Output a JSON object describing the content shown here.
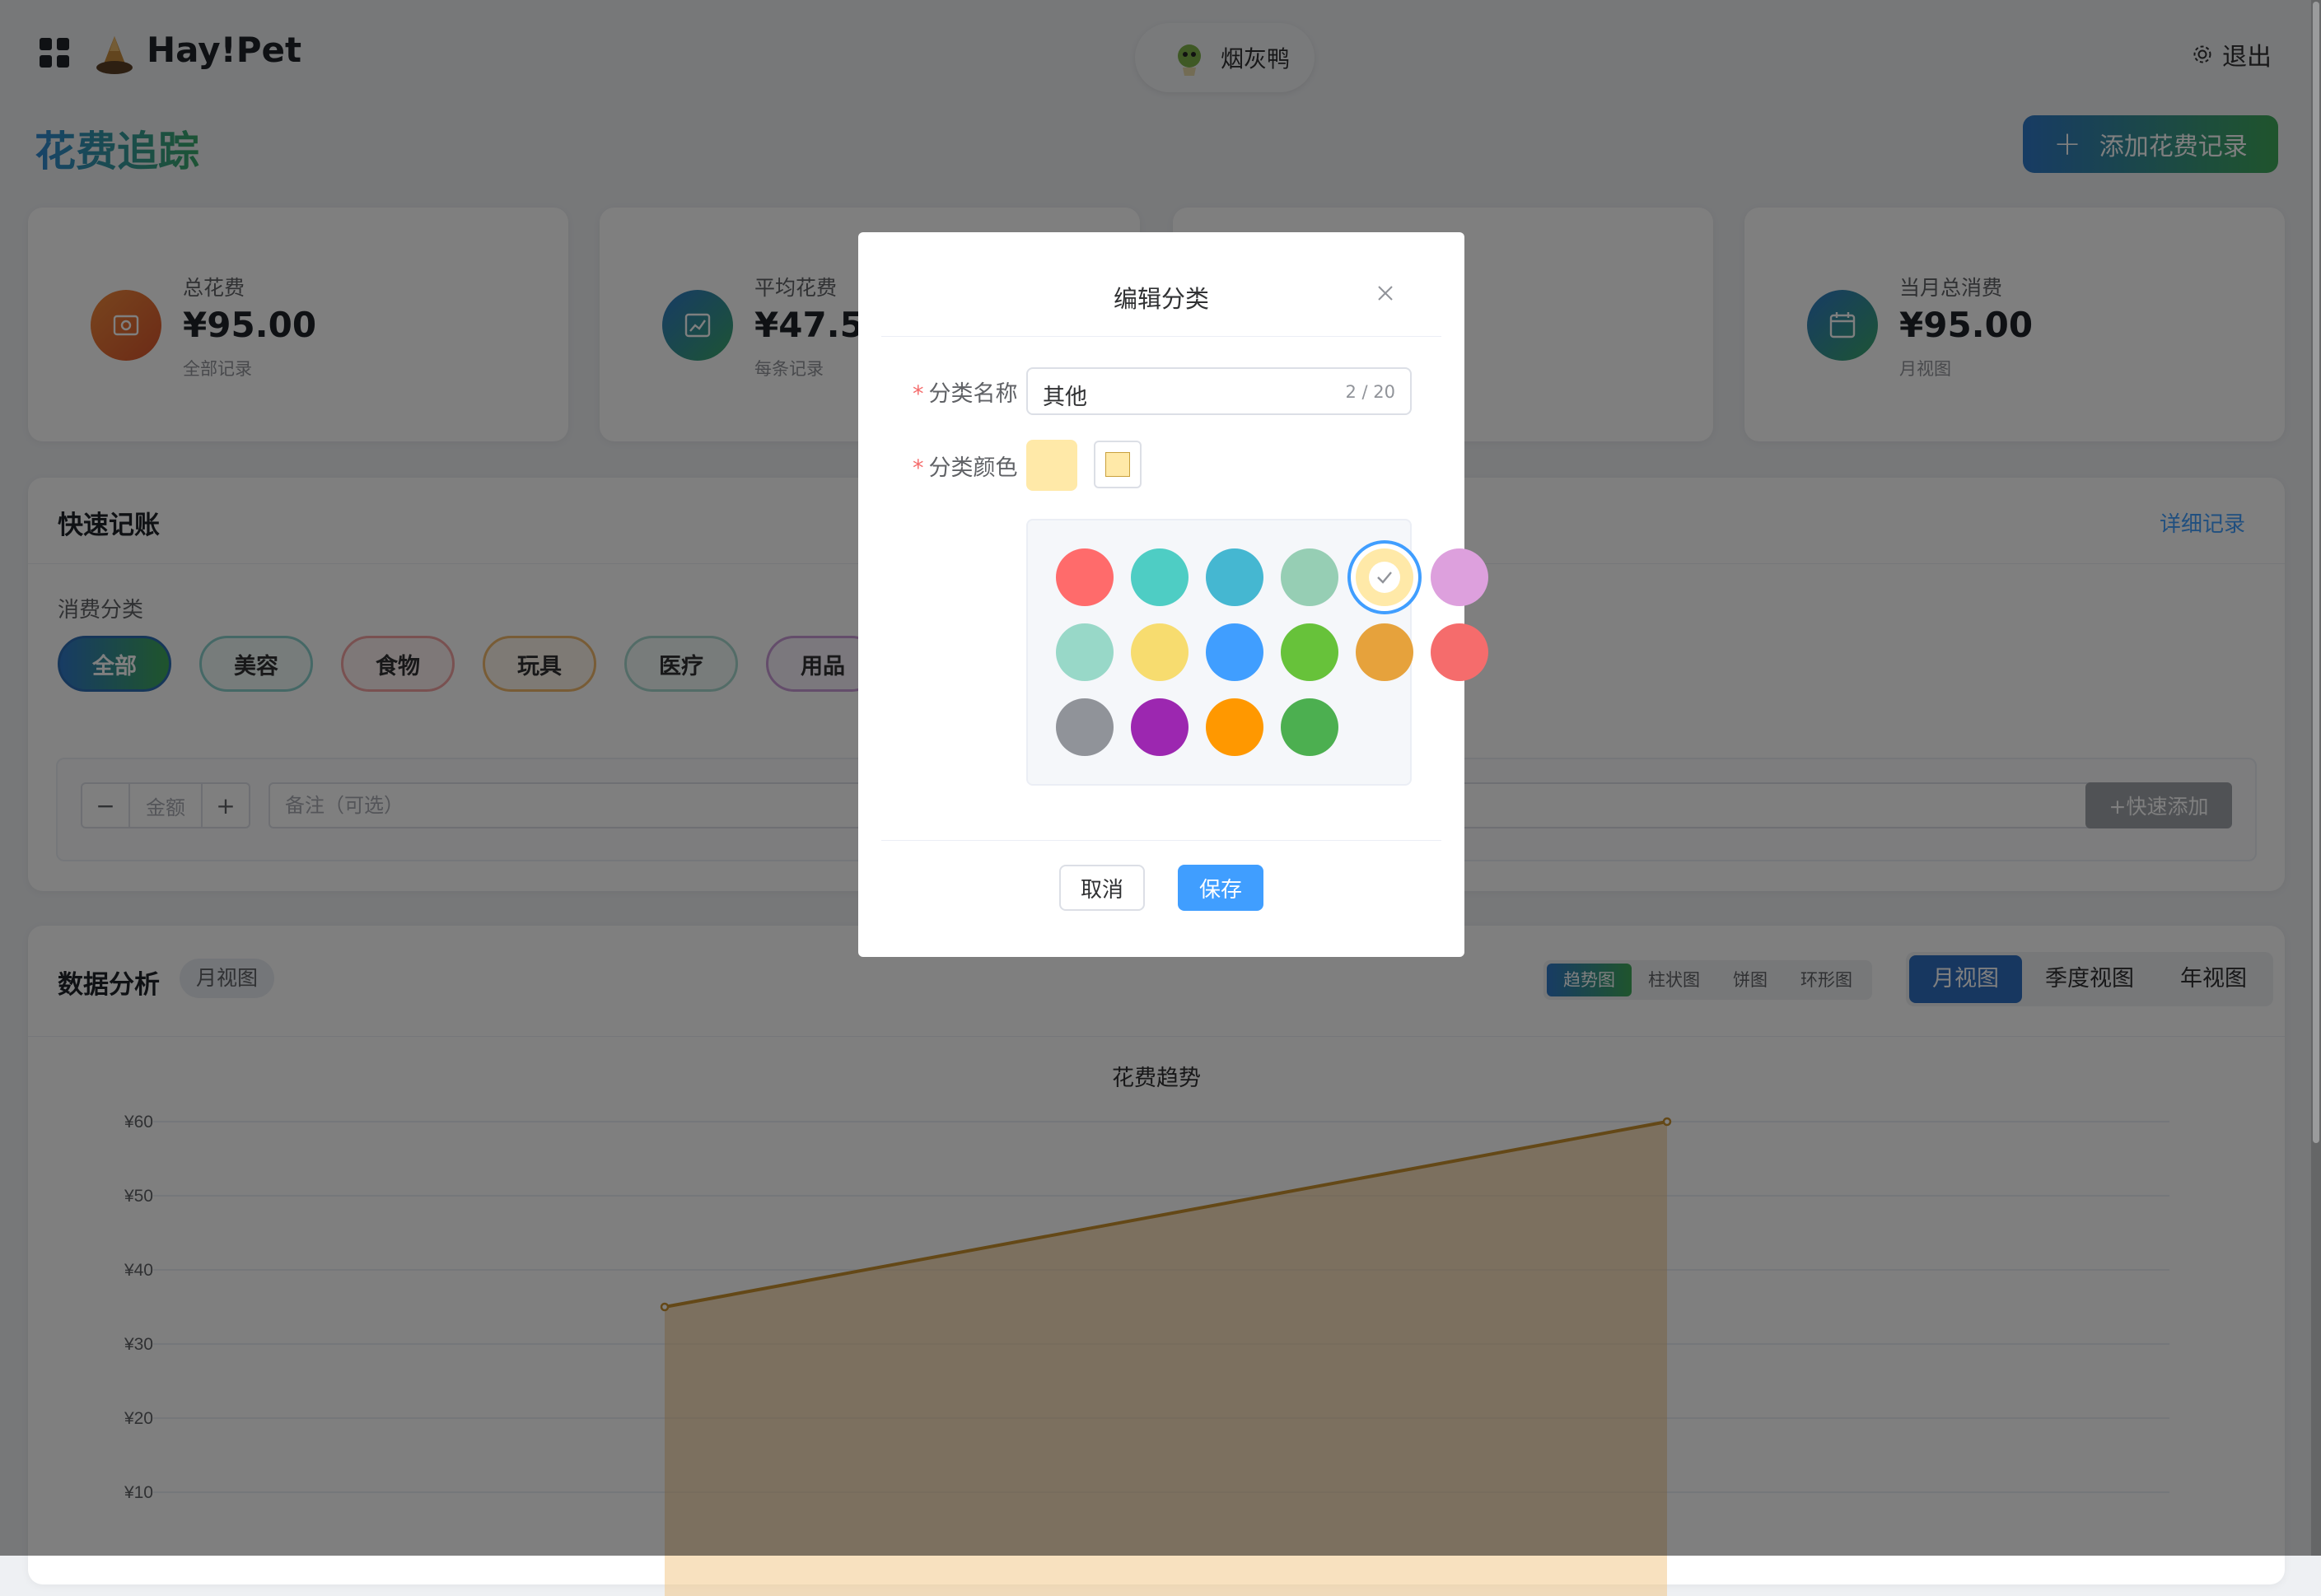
{
  "header": {
    "brand": "Hay!Pet",
    "pet_name": "烟灰鸭",
    "logout_label": "退出"
  },
  "page": {
    "title": "花费追踪",
    "add_button": "添加花费记录"
  },
  "stats": [
    {
      "label": "总花费",
      "value": "¥95.00",
      "sub": "全部记录",
      "icon": "wallet-icon",
      "color": "#e8762e"
    },
    {
      "label": "平均花费",
      "value": "¥47.50",
      "sub": "每条记录",
      "icon": "trend-chart-icon",
      "color": "#2f8f8a"
    },
    {
      "label": "",
      "value": "",
      "sub": "",
      "icon": "",
      "color": ""
    },
    {
      "label": "当月总消费",
      "value": "¥95.00",
      "sub": "月视图",
      "icon": "calendar-icon",
      "color": "#2f8f8a"
    }
  ],
  "quick_record": {
    "title": "快速记账",
    "detail_link": "详细记录",
    "category_label": "消费分类",
    "categories": [
      {
        "label": "全部",
        "border": "#2d6db3"
      },
      {
        "label": "美容",
        "border": "#8ad1cc"
      },
      {
        "label": "食物",
        "border": "#f2a3a3"
      },
      {
        "label": "玩具",
        "border": "#f0b96d"
      },
      {
        "label": "医疗",
        "border": "#a6d8cf"
      },
      {
        "label": "用品",
        "border": "#c89ad6"
      }
    ],
    "minus": "−",
    "plus": "+",
    "amount_placeholder": "金额",
    "note_placeholder": "备注（可选）",
    "quick_add": "+快速添加"
  },
  "analysis": {
    "title": "数据分析",
    "view_tag": "月视图",
    "chart_types": [
      "趋势图",
      "柱状图",
      "饼图",
      "环形图"
    ],
    "active_chart_type": "趋势图",
    "periods": [
      "月视图",
      "季度视图",
      "年视图"
    ],
    "active_period": "月视图"
  },
  "chart_data": {
    "type": "area",
    "title": "花费趋势",
    "y_ticks": [
      "¥60",
      "¥50",
      "¥40",
      "¥30",
      "¥20",
      "¥10"
    ],
    "ylim": [
      0,
      60
    ],
    "values": [
      35,
      60
    ],
    "line_color": "#c8902e",
    "fill_color": "#f2c98a",
    "grid": true
  },
  "dialog": {
    "title": "编辑分类",
    "name_label": "分类名称",
    "name_value": "其他",
    "name_count": "2 / 20",
    "color_label": "分类颜色",
    "selected_color": "#ffe9a8",
    "palette": [
      "#ff6b6b",
      "#4ecdc4",
      "#45b7d1",
      "#96ceb4",
      "#ffe9a8",
      "#dda0dd",
      "#98d8c8",
      "#f7dc6f",
      "#409eff",
      "#67c23a",
      "#e6a23c",
      "#f56c6c",
      "#909399",
      "#9c27b0",
      "#ff9800",
      "#4caf50"
    ],
    "cancel": "取消",
    "save": "保存"
  }
}
